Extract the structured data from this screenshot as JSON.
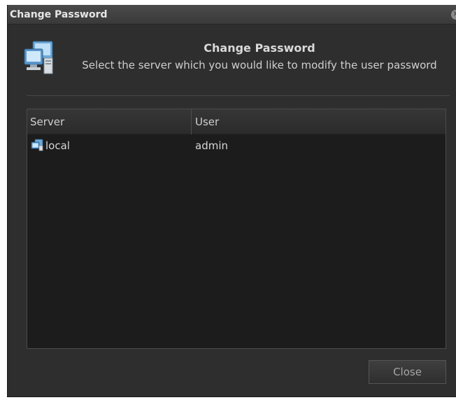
{
  "window": {
    "title": "Change Password",
    "close_glyph": "✕"
  },
  "header": {
    "icon": "computers-icon",
    "title": "Change Password",
    "description": "Select the server which you would like to modify the user password"
  },
  "list": {
    "columns": [
      "Server",
      "User"
    ],
    "rows": [
      {
        "server": "local",
        "user": "admin",
        "icon": "server-icon"
      }
    ]
  },
  "buttons": {
    "close_label": "Close"
  }
}
